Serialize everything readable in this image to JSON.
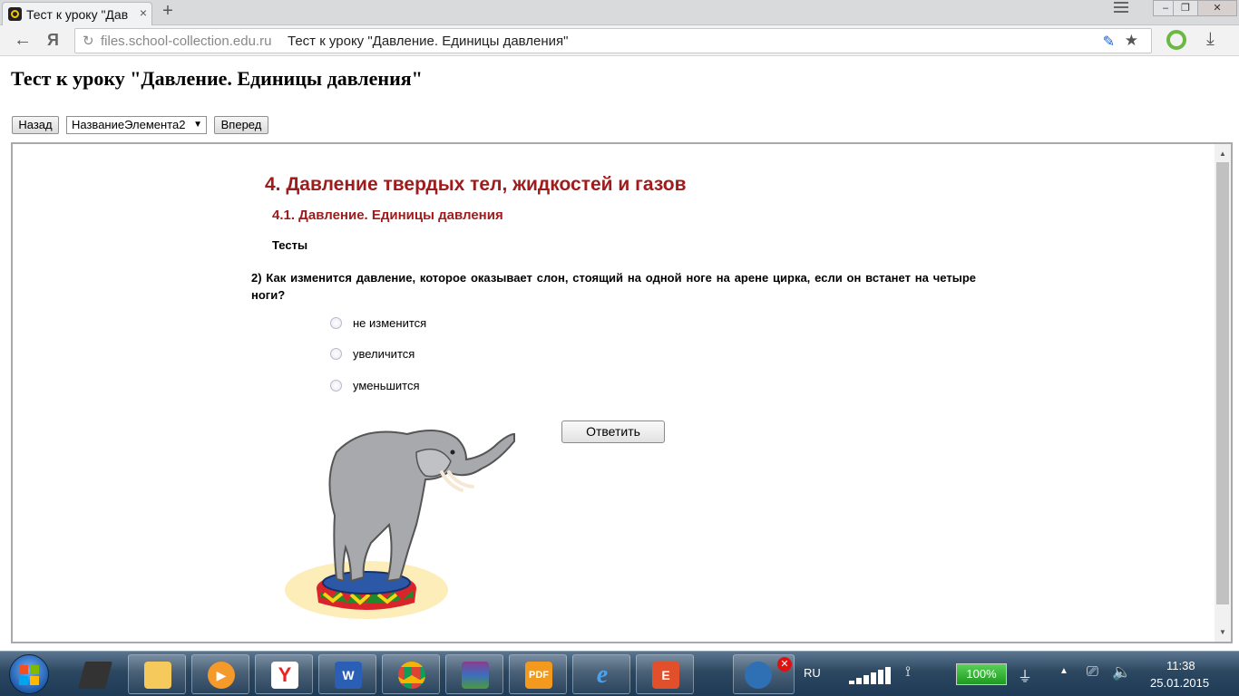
{
  "browser": {
    "tab_title": "Тест к уроку \"Дав",
    "tab_close": "×",
    "new_tab": "+",
    "url_host": "files.school-collection.edu.ru",
    "url_page_title": "Тест к уроку \"Давление. Единицы давления\"",
    "nav_ya": "Я",
    "window_controls": [
      "–",
      "❐",
      "✕"
    ]
  },
  "page": {
    "heading": "Тест к уроку \"Давление. Единицы давления\"",
    "nav": {
      "back_label": "Назад",
      "select_value": "НазваниеЭлемента2",
      "forward_label": "Вперед"
    }
  },
  "content": {
    "section_title": "4. Давление твердых тел, жидкостей и газов",
    "subsection_title": "4.1. Давление. Единицы давления",
    "tests_label": "Тесты",
    "question": "2) Как изменится давление, которое оказывает слон, стоящий на одной ноге на арене цирка, если он встанет на четыре ноги?",
    "options": [
      "не изменится",
      "увеличится",
      "уменьшится"
    ],
    "answer_button": "Ответить",
    "image": "elephant-on-circus-pedestal"
  },
  "taskbar": {
    "apps": [
      "laptop-icon",
      "file-explorer-icon",
      "media-player-icon",
      "yandex-browser-icon",
      "word-icon",
      "chrome-icon",
      "winrar-icon",
      "pdf-reader-icon",
      "internet-explorer-icon",
      "presentation-icon"
    ],
    "language": "RU",
    "battery": "100%",
    "time": "11:38",
    "date": "25.01.2015"
  },
  "colors": {
    "heading_red": "#a01b1b",
    "taskbar_blue": "#2c4760",
    "battery_green": "#1e9a1e"
  }
}
